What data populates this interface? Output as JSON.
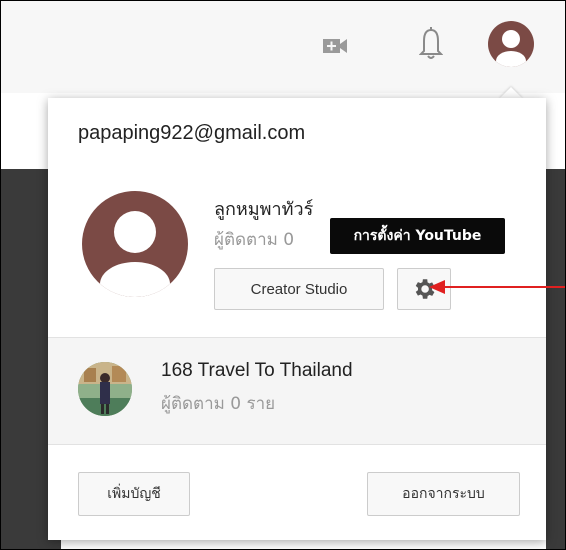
{
  "header": {
    "icons": [
      "video-upload-icon",
      "bell-icon",
      "account-avatar"
    ]
  },
  "account": {
    "email": "papaping922@gmail.com",
    "channel_name": "ลูกหมูพาทัวร์",
    "subs_visible": "ผู้ติดตาม 0"
  },
  "buttons": {
    "creator_studio": "Creator Studio",
    "add_account": "เพิ่มบัญชี",
    "sign_out": "ออกจากระบบ"
  },
  "tooltip": {
    "text": "การตั้งค่า YouTube"
  },
  "brand_account": {
    "name": "168 Travel To Thailand",
    "subs": "ผู้ติดตาม 0 ราย"
  },
  "colors": {
    "avatar": "#7b4a45",
    "arrow": "#e02020",
    "tooltip_bg": "#0a0a0a"
  }
}
